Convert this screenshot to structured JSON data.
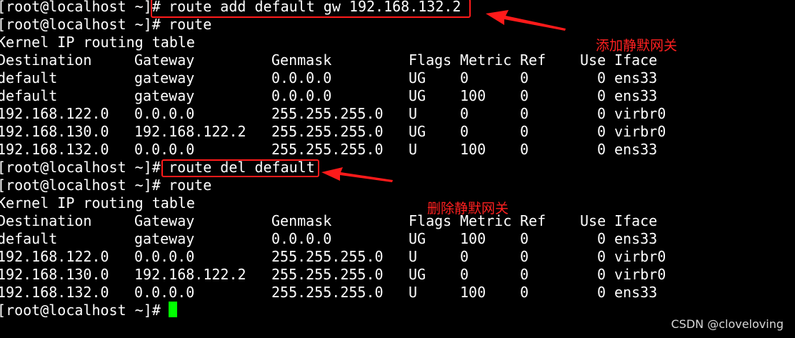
{
  "terminal": {
    "cmd1": {
      "prompt": "[root@localhost ~]#",
      "command": " route add default gw 192.168.132.2"
    },
    "cmd2": {
      "prompt": "[root@localhost ~]#",
      "command": " route"
    },
    "table1": {
      "title": "Kernel IP routing table",
      "headers": [
        "Destination",
        "Gateway",
        "Genmask",
        "Flags",
        "Metric",
        "Ref",
        "Use",
        "Iface"
      ],
      "rows": [
        [
          "default",
          "gateway",
          "0.0.0.0",
          "UG",
          "0",
          "0",
          "0",
          "ens33"
        ],
        [
          "default",
          "gateway",
          "0.0.0.0",
          "UG",
          "100",
          "0",
          "0",
          "ens33"
        ],
        [
          "192.168.122.0",
          "0.0.0.0",
          "255.255.255.0",
          "U",
          "0",
          "0",
          "0",
          "virbr0"
        ],
        [
          "192.168.130.0",
          "192.168.122.2",
          "255.255.255.0",
          "UG",
          "0",
          "0",
          "0",
          "virbr0"
        ],
        [
          "192.168.132.0",
          "0.0.0.0",
          "255.255.255.0",
          "U",
          "100",
          "0",
          "0",
          "ens33"
        ]
      ]
    },
    "cmd3": {
      "prompt": "[root@localhost ~]#",
      "command": " route del default"
    },
    "cmd4": {
      "prompt": "[root@localhost ~]#",
      "command": " route"
    },
    "table2": {
      "title": "Kernel IP routing table",
      "headers": [
        "Destination",
        "Gateway",
        "Genmask",
        "Flags",
        "Metric",
        "Ref",
        "Use",
        "Iface"
      ],
      "rows": [
        [
          "default",
          "gateway",
          "0.0.0.0",
          "UG",
          "100",
          "0",
          "0",
          "ens33"
        ],
        [
          "192.168.122.0",
          "0.0.0.0",
          "255.255.255.0",
          "U",
          "0",
          "0",
          "0",
          "virbr0"
        ],
        [
          "192.168.130.0",
          "192.168.122.2",
          "255.255.255.0",
          "UG",
          "0",
          "0",
          "0",
          "virbr0"
        ],
        [
          "192.168.132.0",
          "0.0.0.0",
          "255.255.255.0",
          "U",
          "100",
          "0",
          "0",
          "ens33"
        ]
      ]
    },
    "final_prompt": "[root@localhost ~]#"
  },
  "annotations": {
    "add_label": "添加静默网关",
    "del_label": "删除静默网关"
  },
  "colors": {
    "background": "#000000",
    "text": "#ffffff",
    "cursor": "#00ff00",
    "annotation": "#ff1a1a"
  },
  "watermark": "CSDN @cloveloving"
}
